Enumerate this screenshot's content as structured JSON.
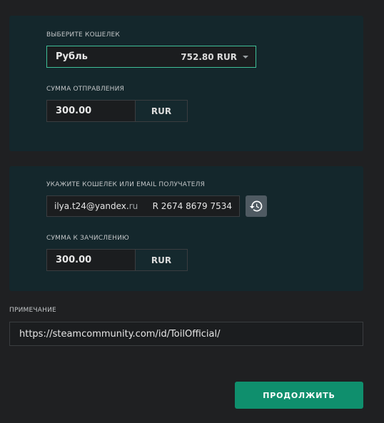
{
  "send": {
    "wallet_label": "ВЫБЕРИТЕ КОШЕЛЕК",
    "wallet_name": "Рубль",
    "wallet_balance": "752.80 RUR",
    "amount_label": "СУММА ОТПРАВЛЕНИЯ",
    "amount_value": "300.00",
    "amount_currency": "RUR"
  },
  "receive": {
    "recipient_label": "УКАЖИТЕ КОШЕЛЕК ИЛИ EMAIL ПОЛУЧАТЕЛЯ",
    "recipient_email_main": "ilya.t24@yandex.",
    "recipient_email_faded": "ru",
    "recipient_account": "R 2674 8679 7534",
    "history_icon": "history-icon",
    "amount_label": "СУММА К ЗАЧИСЛЕНИЮ",
    "amount_value": "300.00",
    "amount_currency": "RUR"
  },
  "note": {
    "label": "ПРИМЕЧАНИЕ",
    "value": "https://steamcommunity.com/id/ToilOfficial/"
  },
  "actions": {
    "continue_label": "ПРОДОЛЖИТЬ"
  },
  "colors": {
    "accent": "#0f8f6d",
    "select_border": "#3fbf98",
    "panel_bg": "#14272c",
    "page_bg": "#1f2022"
  }
}
